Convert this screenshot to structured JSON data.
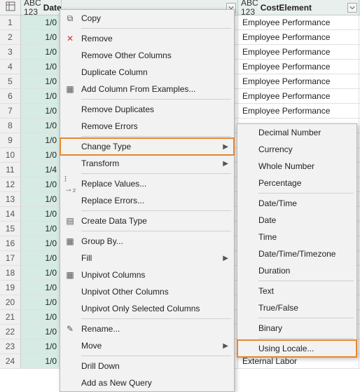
{
  "columns": {
    "date_label": "Date",
    "cost_label": "CostElement",
    "type_prefix": "ABC",
    "type_sub": "123"
  },
  "rows": [
    {
      "n": "1",
      "date": "1/0",
      "cost": "Employee Performance"
    },
    {
      "n": "2",
      "date": "1/0",
      "cost": "Employee Performance"
    },
    {
      "n": "3",
      "date": "1/0",
      "cost": "Employee Performance"
    },
    {
      "n": "4",
      "date": "1/0",
      "cost": "Employee Performance"
    },
    {
      "n": "5",
      "date": "1/0",
      "cost": "Employee Performance"
    },
    {
      "n": "6",
      "date": "1/0",
      "cost": "Employee Performance"
    },
    {
      "n": "7",
      "date": "1/0",
      "cost": "Employee Performance"
    },
    {
      "n": "8",
      "date": "1/0",
      "cost": ""
    },
    {
      "n": "9",
      "date": "1/0",
      "cost": ""
    },
    {
      "n": "10",
      "date": "1/0",
      "cost": ""
    },
    {
      "n": "11",
      "date": "1/4",
      "cost": ""
    },
    {
      "n": "12",
      "date": "1/0",
      "cost": ""
    },
    {
      "n": "13",
      "date": "1/0",
      "cost": ""
    },
    {
      "n": "14",
      "date": "1/0",
      "cost": ""
    },
    {
      "n": "15",
      "date": "1/0",
      "cost": ""
    },
    {
      "n": "16",
      "date": "1/0",
      "cost": ""
    },
    {
      "n": "17",
      "date": "1/0",
      "cost": ""
    },
    {
      "n": "18",
      "date": "1/0",
      "cost": ""
    },
    {
      "n": "19",
      "date": "1/0",
      "cost": ""
    },
    {
      "n": "20",
      "date": "1/0",
      "cost": ""
    },
    {
      "n": "21",
      "date": "1/0",
      "cost": ""
    },
    {
      "n": "22",
      "date": "1/0",
      "cost": ""
    },
    {
      "n": "23",
      "date": "1/0",
      "cost": ""
    },
    {
      "n": "24",
      "date": "1/0",
      "cost": "External Labor"
    }
  ],
  "menu1": {
    "copy": "Copy",
    "remove": "Remove",
    "remove_other": "Remove Other Columns",
    "duplicate": "Duplicate Column",
    "add_examples": "Add Column From Examples...",
    "remove_dup": "Remove Duplicates",
    "remove_err": "Remove Errors",
    "change_type": "Change Type",
    "transform": "Transform",
    "replace_val": "Replace Values...",
    "replace_err": "Replace Errors...",
    "create_dt": "Create Data Type",
    "group_by": "Group By...",
    "fill": "Fill",
    "unpivot": "Unpivot Columns",
    "unpivot_other": "Unpivot Other Columns",
    "unpivot_sel": "Unpivot Only Selected Columns",
    "rename": "Rename...",
    "move": "Move",
    "drill": "Drill Down",
    "add_query": "Add as New Query"
  },
  "menu2": {
    "decimal": "Decimal Number",
    "currency": "Currency",
    "whole": "Whole Number",
    "percentage": "Percentage",
    "datetime": "Date/Time",
    "date": "Date",
    "time": "Time",
    "dttz": "Date/Time/Timezone",
    "duration": "Duration",
    "text": "Text",
    "truefalse": "True/False",
    "binary": "Binary",
    "locale": "Using Locale..."
  }
}
